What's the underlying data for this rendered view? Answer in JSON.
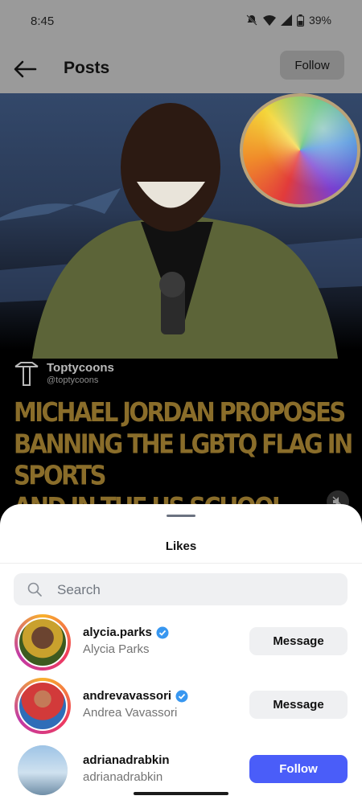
{
  "status_bar": {
    "time": "8:45",
    "battery": "39%"
  },
  "header": {
    "title": "Posts",
    "follow_label": "Follow"
  },
  "post": {
    "brand_name": "Toptycoons",
    "brand_handle": "@toptycoons",
    "headline_lines": [
      "MICHAEL JORDAN PROPOSES",
      "BANNING THE LGBTQ FLAG IN SPORTS",
      "AND IN THE US SCHOOL SYSYTEM"
    ],
    "colors": {
      "headline": "#8a6d2a"
    }
  },
  "likes_sheet": {
    "title": "Likes",
    "search_placeholder": "Search",
    "users": [
      {
        "username": "alycia.parks",
        "full_name": "Alycia Parks",
        "verified": true,
        "action": "Message",
        "story_ring": true
      },
      {
        "username": "andrevavassori",
        "full_name": "Andrea Vavassori",
        "verified": true,
        "action": "Message",
        "story_ring": true
      },
      {
        "username": "adrianadrabkin",
        "full_name": "adrianadrabkin",
        "verified": false,
        "action": "Follow",
        "story_ring": false
      }
    ],
    "colors": {
      "follow_button": "#4a5df9",
      "verified": "#3897f0"
    }
  }
}
